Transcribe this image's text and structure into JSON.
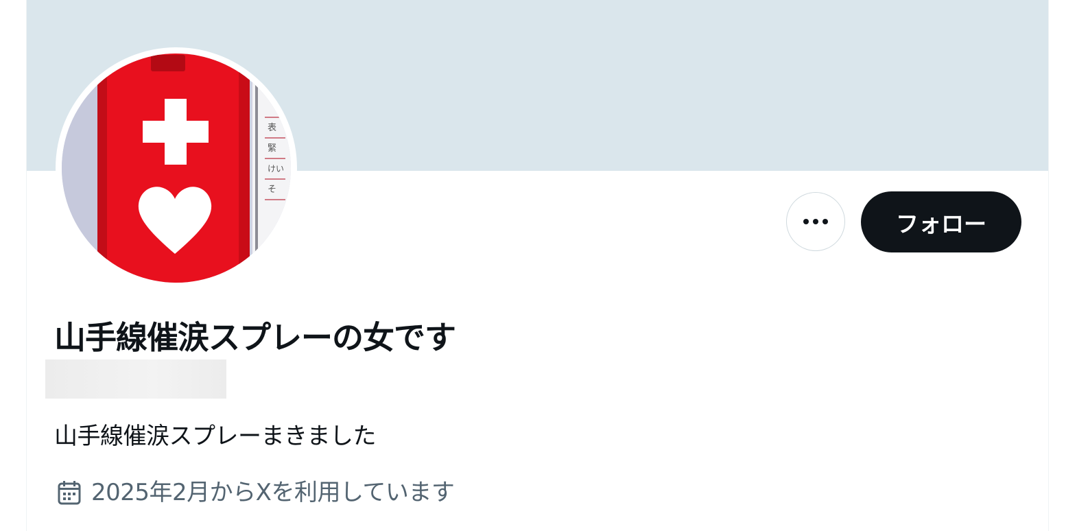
{
  "profile": {
    "display_name": "山手線催涙スプレーの女です",
    "bio": "山手線催涙スプレーまきました",
    "joined": "2025年2月からXを利用しています"
  },
  "actions": {
    "more_icon": "more-horizontal-icon",
    "follow_label": "フォロー"
  },
  "icons": {
    "joined": "calendar-icon"
  },
  "colors": {
    "banner": "#dae6ec",
    "follow_bg": "#0f1419",
    "follow_text": "#ffffff",
    "secondary_text": "#536471",
    "avatar_red": "#e8101e"
  }
}
